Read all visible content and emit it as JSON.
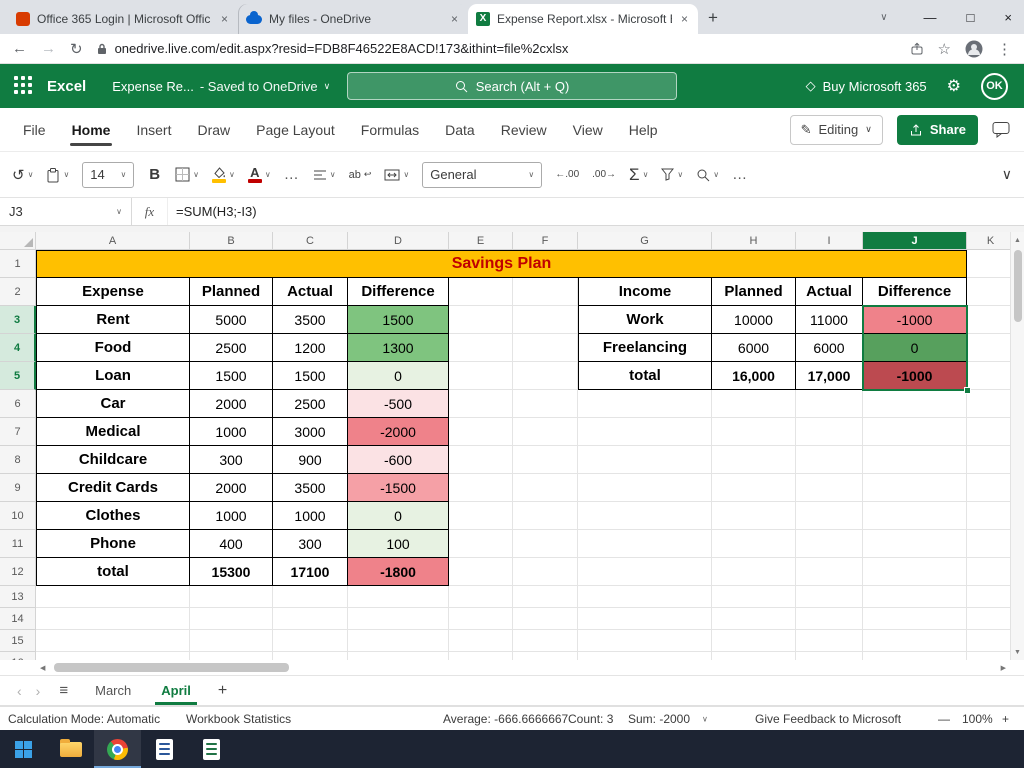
{
  "colors": {
    "excel_green": "#107C41",
    "taskbar": "#1D2433",
    "title_fill": "#FFC000",
    "title_text": "#C00000"
  },
  "icons": {
    "back": "←",
    "forward": "→",
    "reload": "↻",
    "star": "☆",
    "menu_dots": "⋮",
    "minimize": "—",
    "maximize": "□",
    "close": "×",
    "chevron_down": "∨",
    "new_tab": "+",
    "undo": "↺",
    "bold": "B",
    "ellipsis": "…",
    "sigma": "Σ",
    "hamburger": "≡",
    "prev": "‹",
    "next": "›",
    "add_sheet": "+",
    "zoom_out": "—",
    "zoom_in": "+",
    "diamond": "◇",
    "gear": "⚙",
    "pencil": "✎",
    "up": "▲",
    "down": "▼",
    "left": "◀",
    "right": "▶",
    "wrap_arrow": "↩"
  },
  "browser": {
    "tabs": [
      {
        "title": "Office 365 Login | Microsoft Offic",
        "icon": "office-icon",
        "active": false
      },
      {
        "title": "My files - OneDrive",
        "icon": "onedrive-icon",
        "active": false
      },
      {
        "title": "Expense Report.xlsx - Microsoft E",
        "icon": "excel-icon",
        "active": true
      }
    ],
    "url": "onedrive.live.com/edit.aspx?resid=FDB8F46522E8ACD!173&ithint=file%2cxlsx"
  },
  "app_header": {
    "app_name": "Excel",
    "doc_title": "Expense Re...",
    "saved_status": "- Saved to OneDrive",
    "search_label": "Search (Alt + Q)",
    "buy_label": "Buy Microsoft 365",
    "account_initials": "OK"
  },
  "menu": {
    "items": [
      "File",
      "Home",
      "Insert",
      "Draw",
      "Page Layout",
      "Formulas",
      "Data",
      "Review",
      "View",
      "Help"
    ],
    "active_item": "Home",
    "editing_label": "Editing",
    "share_label": "Share"
  },
  "toolbar": {
    "font_size": "14",
    "number_format": "General",
    "decrease_decimal": "←.00",
    "increase_decimal": ".00→"
  },
  "formula_bar": {
    "name_box": "J3",
    "fx_label": "fx",
    "formula": "=SUM(H3;-I3)"
  },
  "sheet": {
    "columns": [
      "A",
      "B",
      "C",
      "D",
      "E",
      "F",
      "G",
      "H",
      "I",
      "J",
      "K"
    ],
    "visible_rows": 16,
    "title": "Savings Plan",
    "expense": {
      "headers": [
        "Expense",
        "Planned",
        "Actual",
        "Difference"
      ],
      "rows": [
        [
          "Rent",
          "5000",
          "3500",
          "1500",
          "green-mid"
        ],
        [
          "Food",
          "2500",
          "1200",
          "1300",
          "green-mid"
        ],
        [
          "Loan",
          "1500",
          "1500",
          "0",
          "green-pale"
        ],
        [
          "Car",
          "2000",
          "2500",
          "-500",
          "pink-pale"
        ],
        [
          "Medical",
          "1000",
          "3000",
          "-2000",
          "red-strong"
        ],
        [
          "Childcare",
          "300",
          "900",
          "-600",
          "pink-pale"
        ],
        [
          "Credit Cards",
          "2000",
          "3500",
          "-1500",
          "pink-mid"
        ],
        [
          "Clothes",
          "1000",
          "1000",
          "0",
          "green-pale"
        ],
        [
          "Phone",
          "400",
          "300",
          "100",
          "green-pale"
        ],
        [
          "total",
          "15300",
          "17100",
          "-1800",
          "red-strong"
        ]
      ]
    },
    "income": {
      "headers": [
        "Income",
        "Planned",
        "Actual",
        "Difference"
      ],
      "rows": [
        [
          "Work",
          "10000",
          "11000",
          "-1000",
          "red-strong"
        ],
        [
          "Freelancing",
          "6000",
          "6000",
          "0",
          "green-dark"
        ],
        [
          "total",
          "16,000",
          "17,000",
          "-1000",
          "red-dark"
        ]
      ]
    },
    "diff_colors": {
      "green-mid": "#7FC47F",
      "green-pale": "#E7F2E2",
      "pink-pale": "#FBE2E4",
      "pink-mid": "#F5A0A6",
      "red-strong": "#EF828A",
      "green-dark": "#57A05D",
      "red-dark": "#BC4A50"
    },
    "selection": {
      "range": "J3:J5",
      "active_cell": "J3",
      "selected_column": "J",
      "selected_rows": [
        3,
        4,
        5
      ]
    }
  },
  "sheet_tabs": {
    "tabs": [
      "March",
      "April"
    ],
    "active": "April"
  },
  "status_bar": {
    "calc_mode": "Calculation Mode: Automatic",
    "workbook_statistics": "Workbook Statistics",
    "average": "Average: -666.6666667",
    "count": "Count: 3",
    "sum": "Sum: -2000",
    "feedback": "Give Feedback to Microsoft",
    "zoom_level": "100%"
  }
}
